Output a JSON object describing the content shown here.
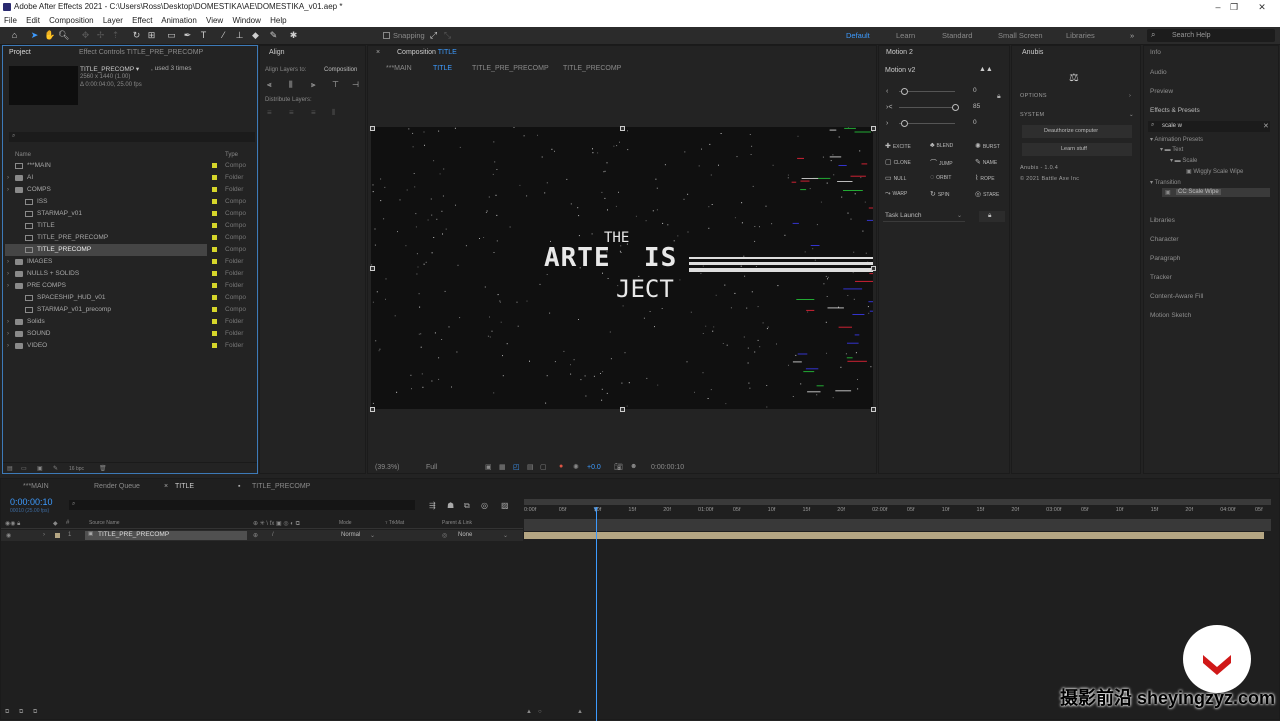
{
  "window": {
    "title": "Adobe After Effects 2021 - C:\\Users\\Ross\\Desktop\\DOMESTIKA\\AE\\DOMESTIKA_v01.aep *",
    "minimize": "–",
    "maximize": "❐",
    "close": "✕"
  },
  "menu": [
    "File",
    "Edit",
    "Composition",
    "Layer",
    "Effect",
    "Animation",
    "View",
    "Window",
    "Help"
  ],
  "toolbar": {
    "snapping": "Snapping",
    "workspaces": [
      "Default",
      "Learn",
      "Standard",
      "Small Screen",
      "Libraries"
    ],
    "search_placeholder": "Search Help"
  },
  "project": {
    "tab": "Project",
    "effect_tab": "Effect Controls TITLE_PRE_PRECOMP",
    "item_name": "TITLE_PRECOMP ▾",
    "used": ", used 3 times",
    "res": "2560 x 1440 (1.00)",
    "dur": "Δ 0:00:04:00, 25.00 fps",
    "col_name": "Name",
    "col_type": "Type",
    "bpc": "16 bpc",
    "items": [
      {
        "name": "***MAIN",
        "type": "Compo",
        "kind": "comp",
        "indent": 0
      },
      {
        "name": "AI",
        "type": "Folder",
        "kind": "folder",
        "indent": 0
      },
      {
        "name": "COMPS",
        "type": "Folder",
        "kind": "folder",
        "indent": 0
      },
      {
        "name": "ISS",
        "type": "Compo",
        "kind": "comp",
        "indent": 1
      },
      {
        "name": "STARMAP_v01",
        "type": "Compo",
        "kind": "comp",
        "indent": 1
      },
      {
        "name": "TITLE",
        "type": "Compo",
        "kind": "comp",
        "indent": 1
      },
      {
        "name": "TITLE_PRE_PRECOMP",
        "type": "Compo",
        "kind": "comp",
        "indent": 1
      },
      {
        "name": "TITLE_PRECOMP",
        "type": "Compo",
        "kind": "comp",
        "indent": 1,
        "selected": true
      },
      {
        "name": "IMAGES",
        "type": "Folder",
        "kind": "folder",
        "indent": 0
      },
      {
        "name": "NULLS + SOLIDS",
        "type": "Folder",
        "kind": "folder",
        "indent": 0
      },
      {
        "name": "PRE COMPS",
        "type": "Folder",
        "kind": "folder",
        "indent": 0
      },
      {
        "name": "SPACESHIP_HUD_v01",
        "type": "Compo",
        "kind": "comp",
        "indent": 1
      },
      {
        "name": "STARMAP_v01_precomp",
        "type": "Compo",
        "kind": "comp",
        "indent": 1
      },
      {
        "name": "Solids",
        "type": "Folder",
        "kind": "folder",
        "indent": 0
      },
      {
        "name": "SOUND",
        "type": "Folder",
        "kind": "folder",
        "indent": 0
      },
      {
        "name": "VIDEO",
        "type": "Folder",
        "kind": "folder",
        "indent": 0
      }
    ]
  },
  "align": {
    "tab": "Align",
    "layers_to": "Align Layers to:",
    "target": "Composition",
    "distribute": "Distribute Layers:"
  },
  "composition": {
    "tab": "Composition",
    "tab_name": "TITLE",
    "breadcrumbs": [
      "***MAIN",
      "TITLE",
      "TITLE_PRE_PRECOMP",
      "TITLE_PRECOMP"
    ],
    "title_top": "THE",
    "title_mid": "ARTE  IS",
    "title_bot": "JECT",
    "zoom": "(39.3%)",
    "quality": "Full",
    "exposure": "+0.0",
    "timecode": "0:00:00:10"
  },
  "motion": {
    "tab": "Motion 2",
    "version": "Motion v2",
    "values": [
      "0",
      "85",
      "0"
    ],
    "buttons": [
      "EXCITE",
      "BLEND",
      "BURST",
      "CLONE",
      "JUMP",
      "NAME",
      "NULL",
      "ORBIT",
      "ROPE",
      "WARP",
      "SPIN",
      "STARE"
    ],
    "task": "Task Launch"
  },
  "anubis": {
    "tab": "Anubis",
    "options": "OPTIONS",
    "system": "SYSTEM",
    "deauth": "Deauthorize computer",
    "learn": "Learn stuff",
    "version": "Anubis - 1.0.4",
    "copyright": "© 2021 Battle Axe Inc"
  },
  "right": {
    "info": "Info",
    "audio": "Audio",
    "preview": "Preview",
    "effects": "Effects & Presets",
    "search": "scale w",
    "tree": [
      "Animation Presets",
      "Text",
      "Scale",
      "Wiggly Scale Wipe",
      "Transition",
      "CC Scale Wipe"
    ],
    "others": [
      "Libraries",
      "Character",
      "Paragraph",
      "Tracker",
      "Content-Aware Fill",
      "Motion Sketch"
    ]
  },
  "timeline": {
    "tabs": [
      "***MAIN",
      "Render Queue",
      "TITLE",
      "TITLE_PRECOMP"
    ],
    "timecode": "0:00:00:10",
    "fps": "00010 (25.00 fps)",
    "cols": {
      "source": "Source Name",
      "mode": "Mode",
      "trkmat": "TrkMat",
      "parent": "Parent & Link"
    },
    "layer": {
      "num": "1",
      "name": "TITLE_PRE_PRECOMP",
      "mode": "Normal",
      "parent": "None"
    },
    "ticks": [
      "0:00f",
      "05f",
      "10f",
      "15f",
      "20f",
      "01:00f",
      "05f",
      "10f",
      "15f",
      "20f",
      "02:00f",
      "05f",
      "10f",
      "15f",
      "20f",
      "03:00f",
      "05f",
      "10f",
      "15f",
      "20f",
      "04:00f",
      "05f"
    ]
  },
  "watermark": {
    "text": "摄影前沿 sheyingzyz.com"
  },
  "colors": {
    "accent": "#2d8ceb",
    "label_yellow": "#d6d62a",
    "bar_tan": "#b5a683",
    "watermark_red": "#d01818"
  }
}
